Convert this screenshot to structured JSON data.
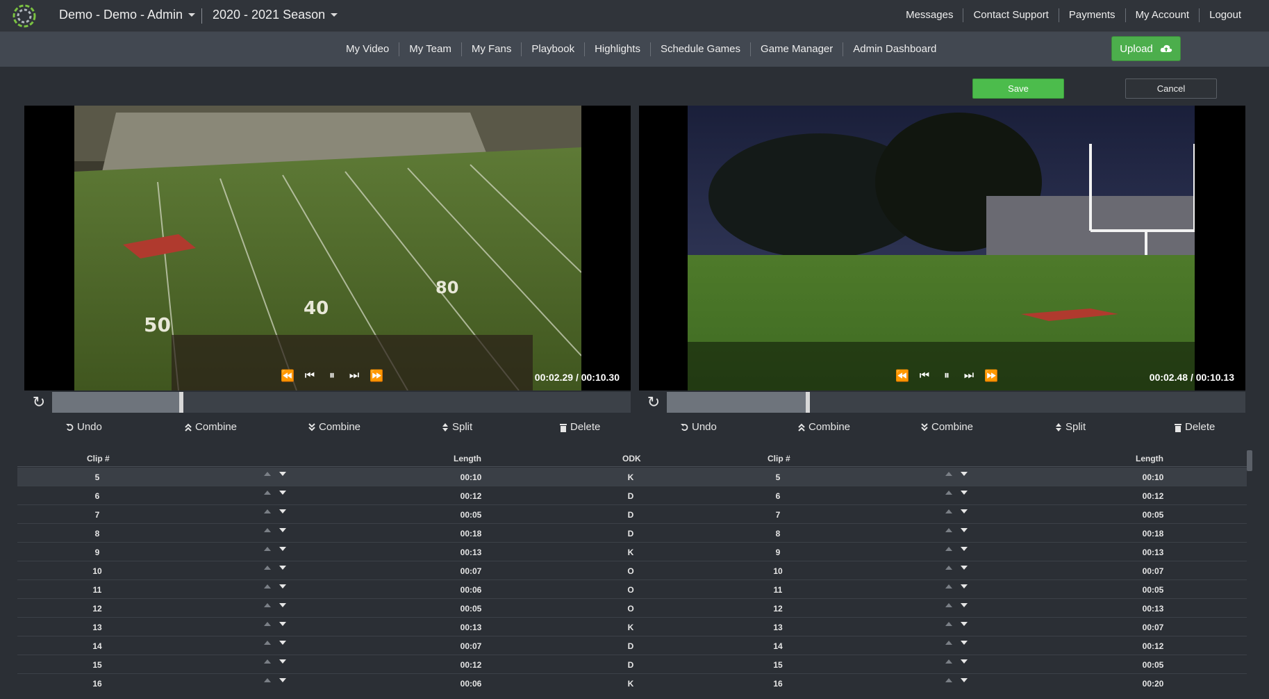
{
  "header": {
    "brand": "Demo - Demo - Admin",
    "season": "2020 - 2021 Season",
    "links": [
      "Messages",
      "Contact Support",
      "Payments",
      "My Account",
      "Logout"
    ]
  },
  "nav": {
    "items": [
      "My Video",
      "My Team",
      "My Fans",
      "Playbook",
      "Highlights",
      "Schedule Games",
      "Game Manager",
      "Admin Dashboard"
    ],
    "upload_label": "Upload"
  },
  "actions": {
    "save_label": "Save",
    "cancel_label": "Cancel"
  },
  "players": {
    "left": {
      "timecode": "00:02.29 / 00:10.30",
      "progress": 0.22
    },
    "right": {
      "timecode": "00:02.48 / 00:10.13",
      "progress": 0.24
    }
  },
  "toolbar": {
    "undo": "Undo",
    "combine_up": "Combine",
    "combine_down": "Combine",
    "split": "Split",
    "delete": "Delete"
  },
  "table": {
    "headers": {
      "clip": "Clip #",
      "length": "Length",
      "odk": "ODK"
    },
    "rows": [
      {
        "clip": "5",
        "len_l": "00:10",
        "odk": "K",
        "len_r": "00:10"
      },
      {
        "clip": "6",
        "len_l": "00:12",
        "odk": "D",
        "len_r": "00:12"
      },
      {
        "clip": "7",
        "len_l": "00:05",
        "odk": "D",
        "len_r": "00:05"
      },
      {
        "clip": "8",
        "len_l": "00:18",
        "odk": "D",
        "len_r": "00:18"
      },
      {
        "clip": "9",
        "len_l": "00:13",
        "odk": "K",
        "len_r": "00:13"
      },
      {
        "clip": "10",
        "len_l": "00:07",
        "odk": "O",
        "len_r": "00:07"
      },
      {
        "clip": "11",
        "len_l": "00:06",
        "odk": "O",
        "len_r": "00:05"
      },
      {
        "clip": "12",
        "len_l": "00:05",
        "odk": "O",
        "len_r": "00:13"
      },
      {
        "clip": "13",
        "len_l": "00:13",
        "odk": "K",
        "len_r": "00:07"
      },
      {
        "clip": "14",
        "len_l": "00:07",
        "odk": "D",
        "len_r": "00:12"
      },
      {
        "clip": "15",
        "len_l": "00:12",
        "odk": "D",
        "len_r": "00:05"
      },
      {
        "clip": "16",
        "len_l": "00:06",
        "odk": "K",
        "len_r": "00:20"
      }
    ]
  }
}
